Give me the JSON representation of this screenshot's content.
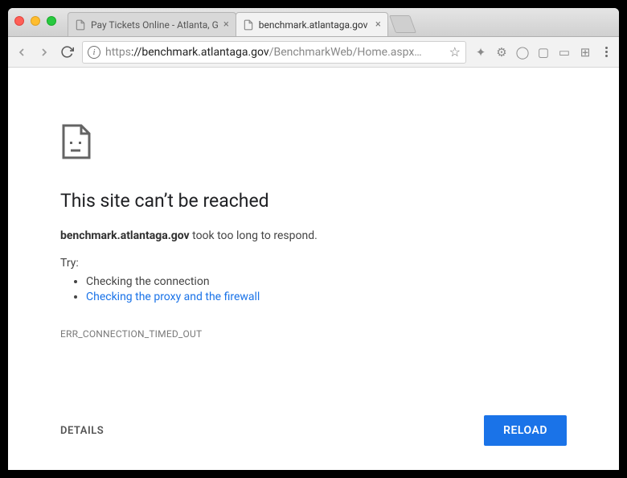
{
  "window": {
    "traffic_lights": [
      "close",
      "minimize",
      "maximize"
    ]
  },
  "tabs": [
    {
      "label": "Pay Tickets Online - Atlanta, G",
      "active": false
    },
    {
      "label": "benchmark.atlantaga.gov",
      "active": true
    }
  ],
  "toolbar": {
    "url_scheme": "https",
    "url_host": "://benchmark.atlantaga.gov",
    "url_path": "/BenchmarkWeb/Home.aspx…",
    "extension_icons": [
      "puzzle-icon",
      "gear-icon",
      "circle-icon",
      "note-icon",
      "dash-icon",
      "barcode-icon"
    ]
  },
  "error": {
    "title": "This site can’t be reached",
    "host_bold": "benchmark.atlantaga.gov",
    "host_rest": " took too long to respond.",
    "try_label": "Try:",
    "try_items": [
      {
        "text": "Checking the connection",
        "link": false
      },
      {
        "text": "Checking the proxy and the firewall",
        "link": true
      }
    ],
    "code": "ERR_CONNECTION_TIMED_OUT",
    "details_label": "DETAILS",
    "reload_label": "RELOAD"
  }
}
